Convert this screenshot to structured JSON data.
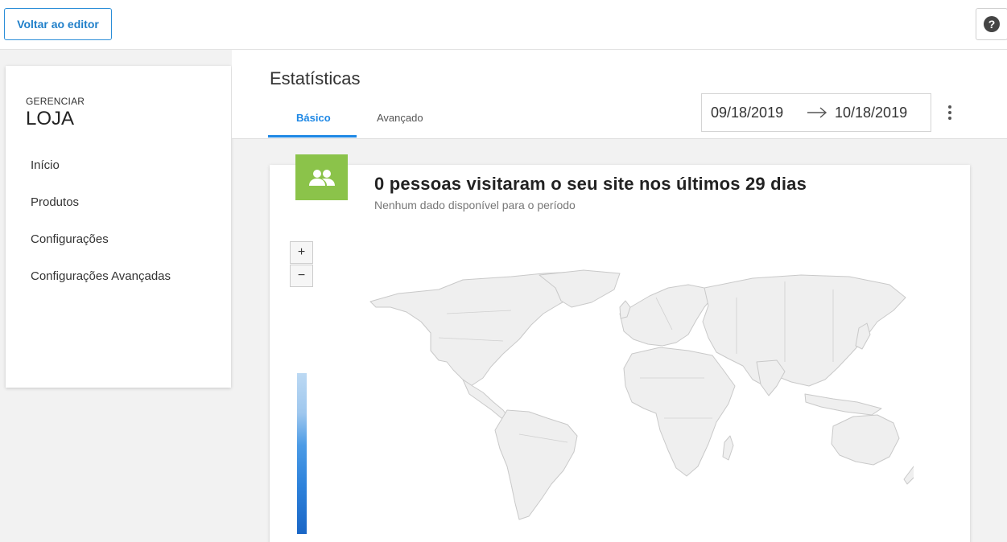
{
  "topbar": {
    "back_label": "Voltar ao editor",
    "help_symbol": "?"
  },
  "sidebar": {
    "kicker": "GERENCIAR",
    "title": "LOJA",
    "items": [
      {
        "label": "Início"
      },
      {
        "label": "Produtos"
      },
      {
        "label": "Configurações"
      },
      {
        "label": "Configurações Avançadas"
      }
    ]
  },
  "main": {
    "title": "Estatísticas",
    "tabs": [
      {
        "label": "Básico",
        "active": true
      },
      {
        "label": "Avançado",
        "active": false
      }
    ],
    "date_range": {
      "start": "09/18/2019",
      "end": "10/18/2019"
    }
  },
  "card": {
    "icon": "people-icon",
    "headline": "0 pessoas visitaram o seu site nos últimos 29 dias",
    "subtitle": "Nenhum dado disponível para o período",
    "zoom_in": "+",
    "zoom_out": "−"
  },
  "colors": {
    "accent": "#1e88e5",
    "icon_bg": "#8bc34a"
  }
}
